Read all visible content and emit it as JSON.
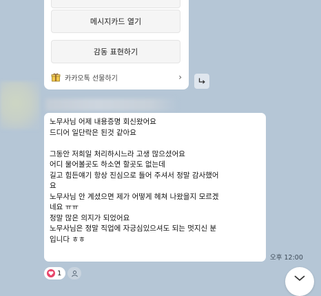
{
  "card": {
    "buttons": [
      {
        "label": "메시지카드 열기"
      },
      {
        "label": "감동 표현하기"
      }
    ],
    "footer_label": "카카오톡 선물하기",
    "footer_icon": "gift-box-icon",
    "chevron_icon": "chevron-right-icon"
  },
  "share_icon": "share-arrow-icon",
  "message": {
    "lines": [
      "노무사님 어제 내용증명 회신왔어요",
      "드디어 일단락은 된것 같아요",
      "",
      "그동안 저희일 처리하시느라 고생 많으셨어요",
      "어디 물어볼곳도 하소연 할곳도 없는데",
      "길고 힘든얘기 항상 진심으로 들어 주셔서 정말 감사했어",
      "요",
      "노무사님 안 계셨으면 제가 어떻게 헤쳐 나왔을지 모르겠",
      "네요 ㅠㅠ",
      "정말 많은 의지가 되었어요",
      "노무사님은 정말 직업에 자긍심있으셔도 되는 멋지신 분",
      "입니다 ㅎㅎ"
    ],
    "time": "오후 12:00"
  },
  "reaction": {
    "icon": "heart-icon",
    "count": "1"
  },
  "add_reaction_icon": "person-icon",
  "scroll_icon": "chevron-down-icon",
  "colors": {
    "background": "#b5c6d6",
    "heart": "#e8466b"
  }
}
